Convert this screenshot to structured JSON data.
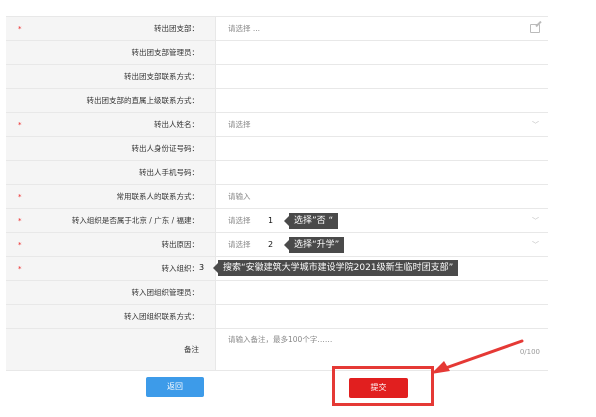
{
  "form": {
    "rows": [
      {
        "label": "转出团支部：",
        "required": true,
        "value": "请选择 ...",
        "control": "edit"
      },
      {
        "label": "转出团支部管理员：",
        "required": false,
        "value": "",
        "control": "none"
      },
      {
        "label": "转出团支部联系方式：",
        "required": false,
        "value": "",
        "control": "none"
      },
      {
        "label": "转出团支部的直属上级联系方式：",
        "required": false,
        "value": "",
        "control": "none"
      },
      {
        "label": "转出人姓名：",
        "required": true,
        "value": "请选择",
        "control": "dropdown"
      },
      {
        "label": "转出人身份证号码：",
        "required": false,
        "value": "",
        "control": "none"
      },
      {
        "label": "转出人手机号码：",
        "required": false,
        "value": "",
        "control": "none"
      },
      {
        "label": "常用联系人的联系方式：",
        "required": true,
        "value": "请输入",
        "control": "none"
      },
      {
        "label": "转入组织是否属于北京 / 广东 / 福建：",
        "required": true,
        "value": "请选择",
        "control": "dropdown"
      },
      {
        "label": "转出原因：",
        "required": true,
        "value": "请选择",
        "control": "dropdown"
      },
      {
        "label": "转入组织：",
        "required": true,
        "value": "",
        "control": "none"
      },
      {
        "label": "转入团组织管理员：",
        "required": false,
        "value": "",
        "control": "none"
      },
      {
        "label": "转入团组织联系方式：",
        "required": false,
        "value": "",
        "control": "none"
      }
    ],
    "remark": {
      "label": "备注",
      "placeholder": "请输入备注，最多100个字……",
      "counter": "0/100"
    },
    "required_mark": "*"
  },
  "annotations": [
    {
      "step": "1",
      "tip": "选择”否 “"
    },
    {
      "step": "2",
      "tip": "选择“升学”"
    },
    {
      "step": "3",
      "tip": "搜索“安徽建筑大学城市建设学院2021级新生临时团支部”"
    }
  ],
  "buttons": {
    "back": "返回",
    "submit": "提交"
  },
  "colors": {
    "required": "#ee2222",
    "back": "#3d9be9",
    "submit": "#e11f1f",
    "highlight": "#e53935",
    "tip_bg": "#4a4a4a"
  }
}
